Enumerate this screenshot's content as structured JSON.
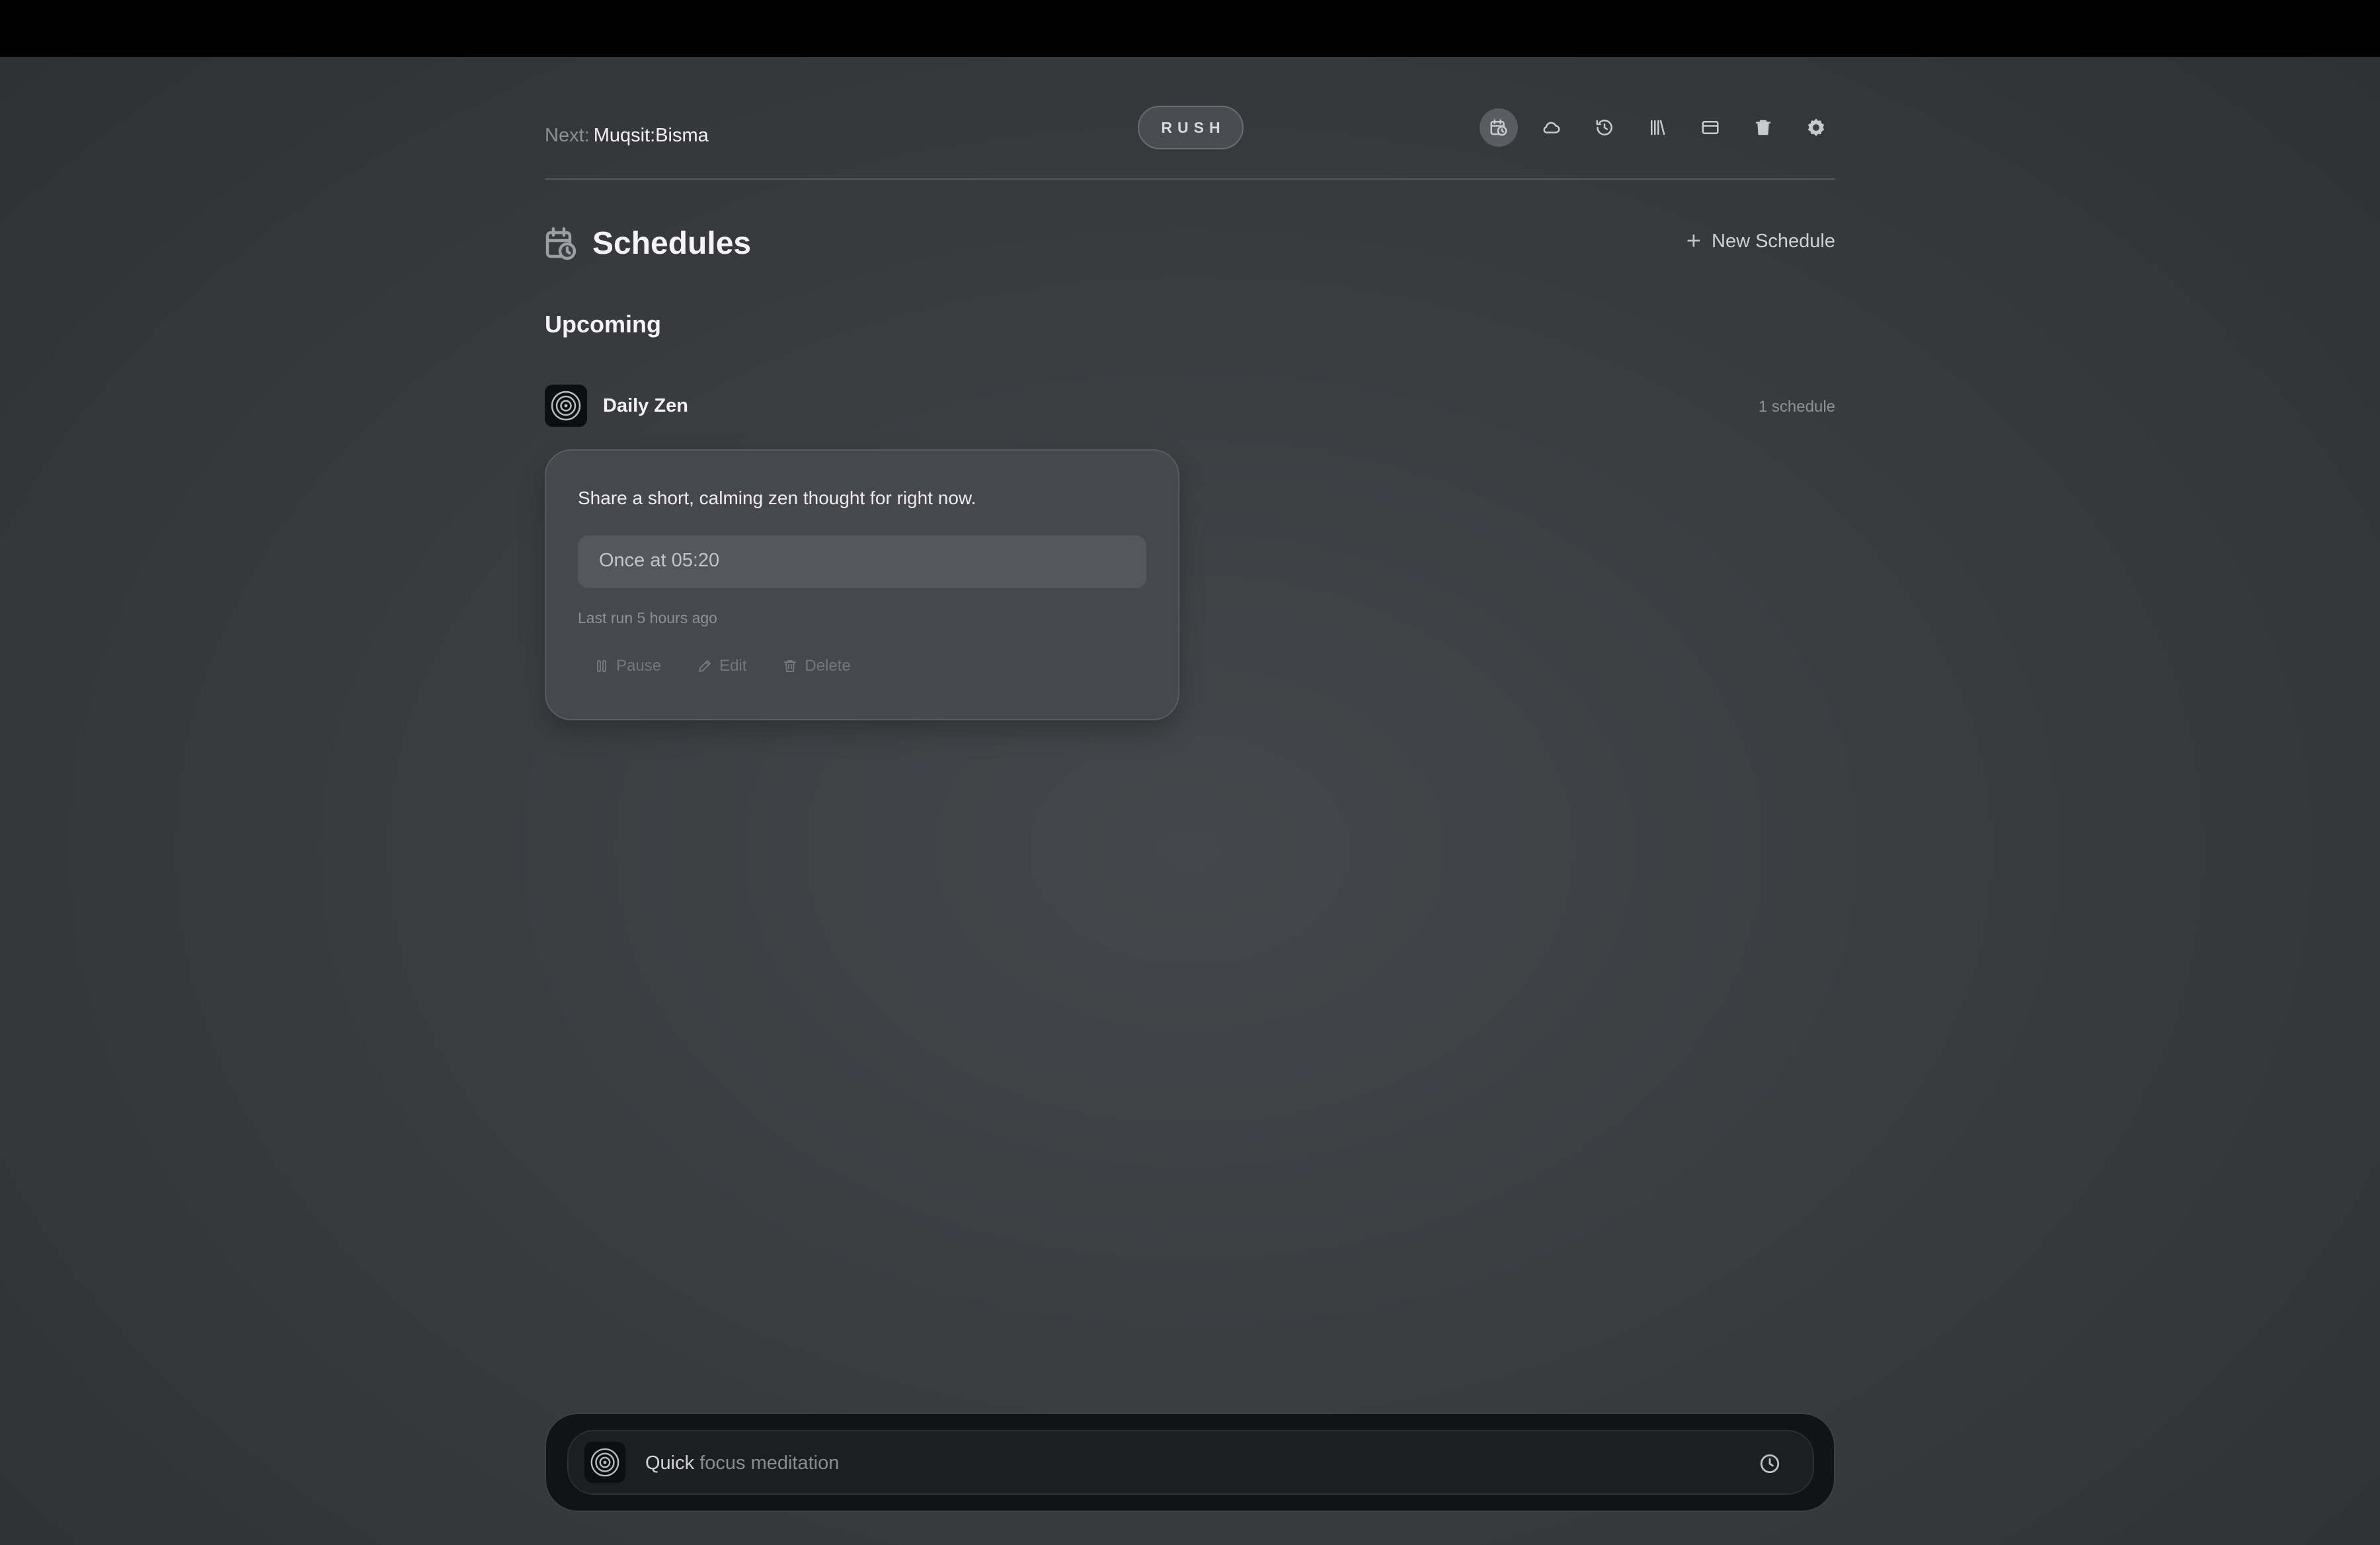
{
  "header": {
    "next_label": "Next:",
    "next_value": "Muqsit:Bisma",
    "rush_label": "RUSH",
    "icons": [
      "schedule-icon",
      "cloud-icon",
      "history-icon",
      "library-icon",
      "card-icon",
      "trash-icon",
      "settings-icon"
    ]
  },
  "page": {
    "title": "Schedules",
    "new_schedule_label": "New Schedule",
    "section_label": "Upcoming"
  },
  "group": {
    "name": "Daily Zen",
    "count_label": "1 schedule"
  },
  "schedule_card": {
    "prompt": "Share a short, calming zen thought for right now.",
    "when": "Once at 05:20",
    "last_run": "Last run 5 hours ago",
    "pause_label": "Pause",
    "edit_label": "Edit",
    "delete_label": "Delete"
  },
  "composer": {
    "typed_text": "Quick",
    "ghost_text": " focus meditation"
  },
  "colors": {
    "background": "#3a3c40",
    "card": "#46484d",
    "composer": "#121315",
    "topbar": "#000000"
  }
}
